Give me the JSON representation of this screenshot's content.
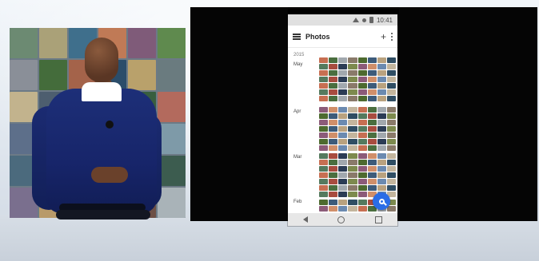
{
  "phone": {
    "status_time": "10:41",
    "app_title": "Photos",
    "toolbar": {
      "menu_icon": "hamburger-menu-icon",
      "add_icon": "plus-icon",
      "more_icon": "more-vert-icon"
    },
    "year": "2015",
    "months": [
      "May",
      "Apr",
      "Mar",
      "Feb"
    ]
  },
  "mosaic_colors": [
    "#6c8a72",
    "#aaa178",
    "#3f6f8c",
    "#c07a56",
    "#7f5b79",
    "#5f8a4e",
    "#8a8f98",
    "#446c3b",
    "#a4634a",
    "#2b4d6a",
    "#b9a16b",
    "#6a7b7f",
    "#c2b38d",
    "#4d5e6f",
    "#7c6a5b",
    "#93a0a8",
    "#385e3f",
    "#b36a5d",
    "#5d6f8a",
    "#9d8e6b",
    "#4c7a6a",
    "#c5c0b3",
    "#6b5a4f",
    "#7e9aa8",
    "#4b6a7d",
    "#8aa17a",
    "#a57e62",
    "#59606b",
    "#bda88e",
    "#3c5c4f",
    "#7a6f8e",
    "#b89a6a",
    "#556b88",
    "#8d9a6f",
    "#6d4f45",
    "#a9b3b8"
  ],
  "photo_colors": [
    "#3d5b7a",
    "#c76f52",
    "#7d8a4e",
    "#b9a27f",
    "#4a6e3f",
    "#8c5b79",
    "#2f4d63",
    "#a1a8ae",
    "#d08f6a",
    "#557a5e",
    "#8a7a6a",
    "#6b8ab0",
    "#a84c3f",
    "#4d6a2f",
    "#c3b59d",
    "#2b3c55"
  ]
}
